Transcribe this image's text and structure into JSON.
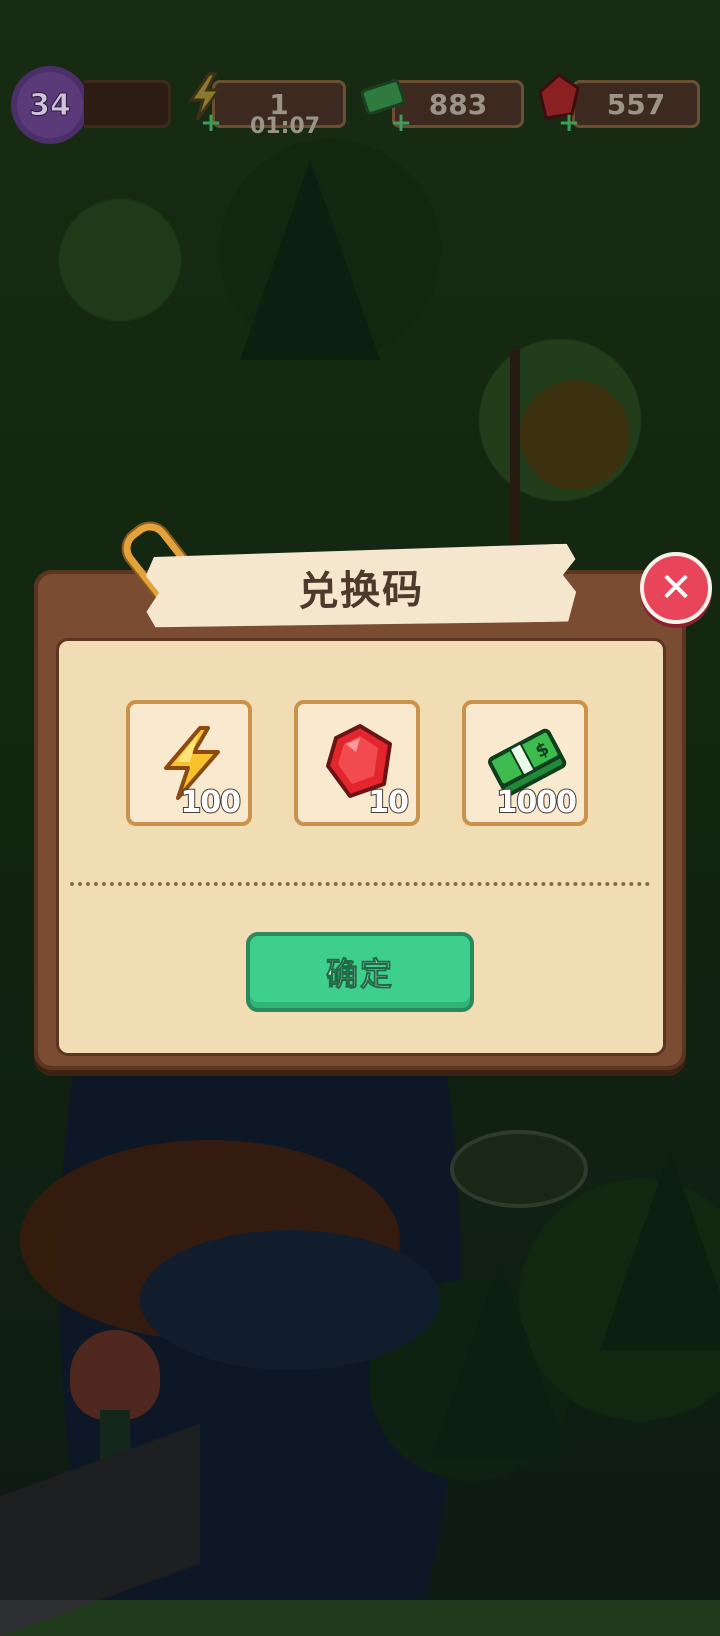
{
  "hud": {
    "level": "34",
    "energy": {
      "value": "1",
      "timer": "01:07"
    },
    "cash": {
      "value": "883"
    },
    "gems": {
      "value": "557"
    }
  },
  "modal": {
    "title": "兑换码",
    "rewards": [
      {
        "icon": "lightning-icon",
        "amount": "100"
      },
      {
        "icon": "gem-icon",
        "amount": "10"
      },
      {
        "icon": "cash-icon",
        "amount": "1000"
      }
    ],
    "confirm_label": "确定",
    "close_label": "✕"
  },
  "colors": {
    "panel": "#7a4c32",
    "panel_inner": "#f1ddb4",
    "confirm": "#3fcf8d",
    "close": "#e8455a"
  }
}
